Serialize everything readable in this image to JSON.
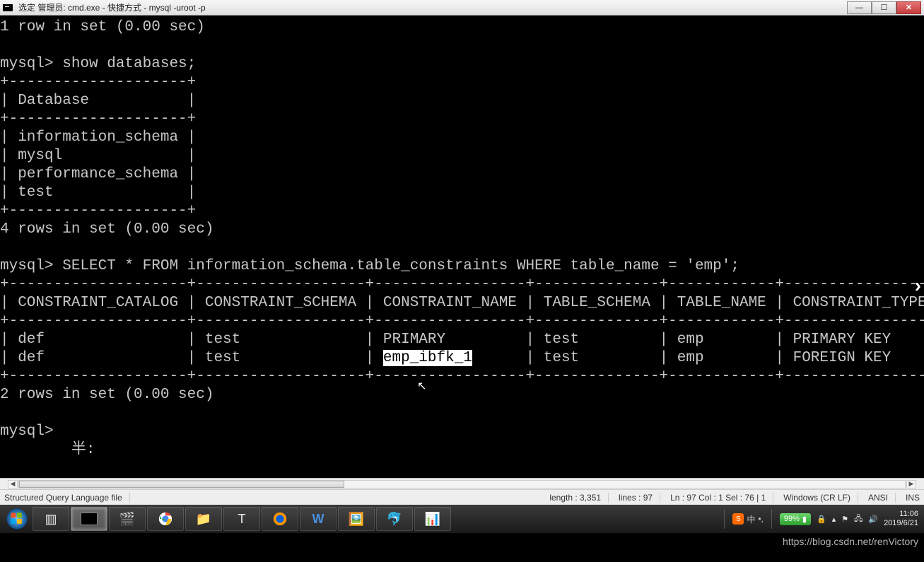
{
  "window": {
    "title": "选定 管理员: cmd.exe - 快捷方式 - mysql  -uroot -p"
  },
  "terminal": {
    "line_prev": "1 row in set (0.00 sec)",
    "prompt1": "mysql> show databases;",
    "db_border": "+--------------------+",
    "db_header": "| Database           |",
    "db_rows": [
      "| information_schema |",
      "| mysql              |",
      "| performance_schema |",
      "| test               |"
    ],
    "rows_in_set4": "4 rows in set (0.00 sec)",
    "prompt2": "mysql> SELECT * FROM information_schema.table_constraints WHERE table_name = 'emp';",
    "constraint_border": "+--------------------+-------------------+-----------------+--------------+------------+-----------------+",
    "constraint_header": "| CONSTRAINT_CATALOG | CONSTRAINT_SCHEMA | CONSTRAINT_NAME | TABLE_SCHEMA | TABLE_NAME | CONSTRAINT_TYPE |",
    "constraint_row1": "| def                | test              | PRIMARY         | test         | emp        | PRIMARY KEY     |",
    "constraint_row2_before": "| def                | test              | ",
    "constraint_row2_sel": "emp_ibfk_1",
    "constraint_row2_after": "      | test         | emp        | FOREIGN KEY     |",
    "rows_in_set2": "2 rows in set (0.00 sec)",
    "prompt3": "mysql> ",
    "misc_chars": "        半:"
  },
  "statusbar": {
    "filetype": "Structured Query Language file",
    "length": "length : 3,351",
    "lines": "lines : 97",
    "pos": "Ln : 97   Col : 1   Sel : 76 | 1",
    "eol": "Windows (CR LF)",
    "encoding": "ANSI",
    "mode": "INS"
  },
  "tray": {
    "battery": "99%",
    "time": "11:06",
    "date": "2019/6/21"
  },
  "watermark": "https://blog.csdn.net/renVictory"
}
